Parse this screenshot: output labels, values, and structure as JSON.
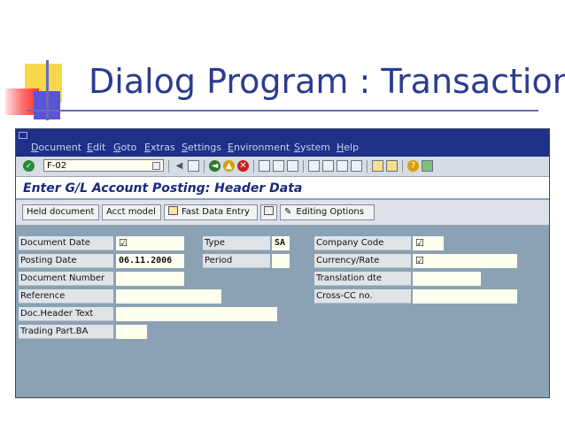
{
  "slide": {
    "title": "Dialog Program : Transaction"
  },
  "menu": {
    "items": [
      {
        "label": "Document",
        "underline": "D",
        "rest": "ocument"
      },
      {
        "label": "Edit",
        "underline": "E",
        "rest": "dit"
      },
      {
        "label": "Goto",
        "underline": "G",
        "rest": "oto"
      },
      {
        "label": "Extras",
        "underline": "E",
        "rest": "xtras"
      },
      {
        "label": "Settings",
        "underline": "S",
        "rest": "ettings"
      },
      {
        "label": "Environment",
        "underline": "E",
        "rest": "nvironment"
      },
      {
        "label": "System",
        "underline": "S",
        "rest": "ystem"
      },
      {
        "label": "Help",
        "underline": "H",
        "rest": "elp"
      }
    ]
  },
  "toolbar": {
    "command_value": "F-02",
    "icons": [
      "enter-icon",
      "save-icon",
      "back-icon",
      "exit-icon",
      "cancel-icon",
      "print-icon",
      "find-icon",
      "find-next-icon",
      "first-page-icon",
      "previous-page-icon",
      "next-page-icon",
      "last-page-icon",
      "create-session-icon",
      "shortcut-icon",
      "help-icon",
      "layout-menu-icon"
    ]
  },
  "screen": {
    "title": "Enter G/L Account Posting: Header Data"
  },
  "app_toolbar": {
    "held_document": "Held document",
    "acct_model": "Acct model",
    "fast_data_entry": "Fast Data Entry",
    "editing_options": "Editing Options"
  },
  "form": {
    "document_date": {
      "label": "Document Date",
      "value": "☑"
    },
    "posting_date": {
      "label": "Posting Date",
      "value": "06.11.2006"
    },
    "document_number": {
      "label": "Document Number",
      "value": ""
    },
    "reference": {
      "label": "Reference",
      "value": ""
    },
    "doc_header_text": {
      "label": "Doc.Header Text",
      "value": ""
    },
    "trading_part_ba": {
      "label": "Trading Part.BA",
      "value": ""
    },
    "type": {
      "label": "Type",
      "value": "SA"
    },
    "period": {
      "label": "Period",
      "value": ""
    },
    "company_code": {
      "label": "Company Code",
      "value": "☑"
    },
    "currency_rate": {
      "label": "Currency/Rate",
      "value": "☑"
    },
    "translation_dte": {
      "label": "Translation dte",
      "value": ""
    },
    "cross_cc_no": {
      "label": "Cross-CC no.",
      "value": ""
    }
  }
}
